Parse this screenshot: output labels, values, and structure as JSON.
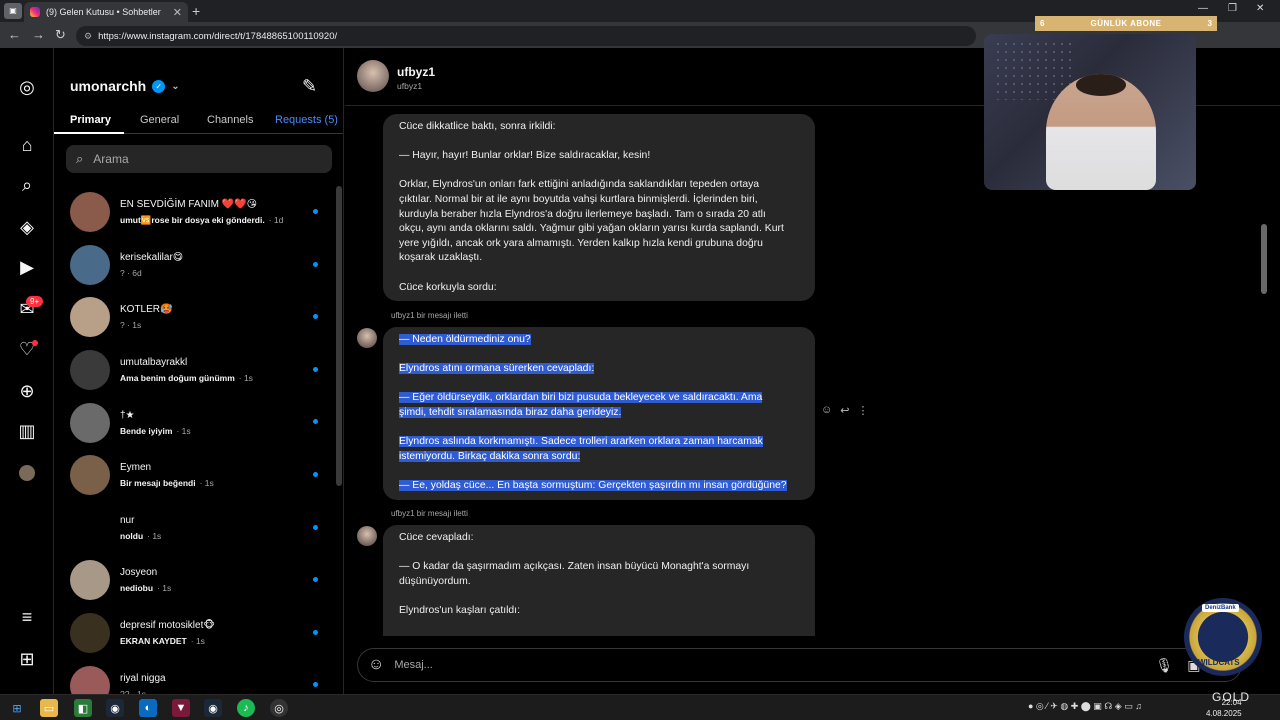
{
  "browser": {
    "tab_title": "(9) Gelen Kutusu • Sohbetler",
    "url": "https://www.instagram.com/direct/t/17848865100110920/",
    "new_tab": "+",
    "tab_close": "✕"
  },
  "rail": {
    "messages_badge": "9+"
  },
  "inbox": {
    "username": "umonarchh",
    "tabs": [
      "Primary",
      "General",
      "Channels",
      "Requests (5)"
    ],
    "search_placeholder": "Arama",
    "conversations": [
      {
        "name": "EN SEVDİĞİM FANIM ❤️❤️😘",
        "preview_bold": "umut🆚rose bir dosya eki gönderdi.",
        "time": "· 1d",
        "color": "#8a5a4a"
      },
      {
        "name": "kerisekalilar😋",
        "preview_bold": "",
        "preview": "? · 6d",
        "color": "#4a6a8a"
      },
      {
        "name": "KOTLER🥵",
        "preview_bold": "",
        "preview": "? · 1s",
        "color": "#b8a088"
      },
      {
        "name": "umutalbayrakkl",
        "preview_bold": "Ama benim doğum günümm",
        "time": "· 1s",
        "color": "#3a3a3a"
      },
      {
        "name": "†★",
        "preview_bold": "Bende iyiyim",
        "time": "· 1s",
        "color": "#6a6a6a"
      },
      {
        "name": "Eymen",
        "preview_bold": "Bir mesajı beğendi",
        "time": "· 1s",
        "color": "#7a6048"
      },
      {
        "name": "nur",
        "preview_bold": "noldu",
        "time": "· 1s",
        "color": "#000000"
      },
      {
        "name": "Josyeon",
        "preview_bold": "nediobu",
        "time": "· 1s",
        "color": "#a89888"
      },
      {
        "name": "depresif motosiklet🐵",
        "preview_bold": "EKRAN KAYDET",
        "time": "· 1s",
        "color": "#3a3020"
      },
      {
        "name": "riyal nigga",
        "preview_bold": "",
        "preview": "?? · 1s",
        "color": "#9a5a5a"
      }
    ]
  },
  "chat": {
    "name": "ufbyz1",
    "handle": "ufbyz1",
    "forwarded_label": "ufbyz1 bir mesajı iletti",
    "bubble1": [
      "Cüce dikkatlice baktı, sonra irkildi:",
      "",
      "— Hayır, hayır! Bunlar orklar! Bize saldıracaklar, kesin!",
      "",
      "Orklar, Elyndros'un onları fark ettiğini anladığında saklandıkları tepeden ortaya",
      "çıktılar. Normal bir at ile aynı boyutda vahşi kurtlara binmişlerdi. İçlerinden biri,",
      "kurduyla beraber hızla Elyndros'a doğru ilerlemeye başladı. Tam o sırada 20 atlı",
      "okçu, aynı anda oklarını saldı. Yağmur gibi yağan okların yarısı kurda saplandı. Kurt",
      "yere yığıldı, ancak ork yara almamıştı. Yerden kalkıp hızla kendi grubuna doğru",
      "koşarak uzaklaştı.",
      "",
      "Cüce korkuyla sordu:"
    ],
    "bubble2": [
      "— Neden öldürmediniz onu?",
      "",
      "Elyndros atını ormana sürerken cevapladı:",
      "",
      "— Eğer öldürseydik, orklardan biri bizi pusuda bekleyecek ve saldıracaktı. Ama",
      "şimdi, tehdit sıralamasında biraz daha gerideyiz.",
      "",
      "Elyndros aslında korkmamıştı. Sadece trolleri ararken orklara zaman harcamak",
      "istemiyordu. Birkaç dakika sonra sordu:",
      "",
      "— Ee, yoldaş cüce... En başta sormuştum: Gerçekten şaşırdın mı insan gördüğüne?"
    ],
    "bubble3": [
      "Cüce cevapladı:",
      "",
      "— O kadar da şaşırmadım açıkçası. Zaten insan büyücü Monaght'a sormayı",
      "düşünüyordum.",
      "",
      "Elyndros'un kaşları çatıldı:"
    ],
    "composer_placeholder": "Mesaj..."
  },
  "overlay": {
    "sub_left": "6",
    "sub_title": "GÜNLÜK ABONE",
    "sub_right": "3",
    "badge_bank": "DenizBank",
    "badge_team": "WILDCATS",
    "gold": "GOLD"
  },
  "taskbar": {
    "date": "4.08.2025",
    "time": "22:04"
  }
}
